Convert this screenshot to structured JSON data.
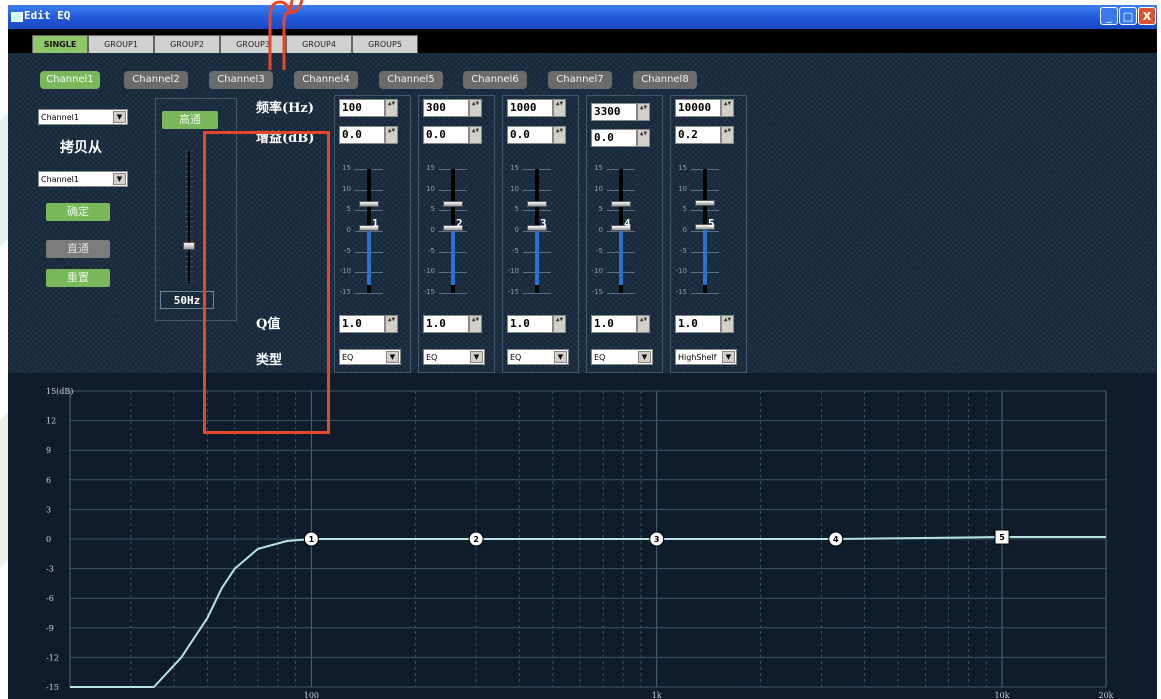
{
  "window": {
    "title": "Edit EQ",
    "min_label": "_",
    "max_label": "□",
    "close_label": "X"
  },
  "tabs": [
    "SINGLE",
    "GROUP1",
    "GROUP2",
    "GROUP3",
    "GROUP4",
    "GROUP5"
  ],
  "active_tab": "SINGLE",
  "channels": [
    "Channel1",
    "Channel2",
    "Channel3",
    "Channel4",
    "Channel5",
    "Channel6",
    "Channel7",
    "Channel8"
  ],
  "active_channel": "Channel1",
  "copy": {
    "source_select": "Channel1",
    "copy_from_label": "拷贝从",
    "target_select": "Channel1",
    "confirm_label": "确定",
    "bypass_label": "直通",
    "reset_label": "重置"
  },
  "highpass": {
    "button_label": "高通",
    "frequency": "50Hz",
    "slider_level": 0.13
  },
  "labels": {
    "freq": "频率(Hz)",
    "gain": "增益(dB)",
    "q": "Q值",
    "type": "类型"
  },
  "slider_scale": [
    "15",
    "10",
    "5",
    "0",
    "-5",
    "-10",
    "-15"
  ],
  "bands": [
    {
      "num": "1",
      "freq": "100",
      "gain": "0.0",
      "q": "1.0",
      "type": "EQ",
      "gain_db": 0.0
    },
    {
      "num": "2",
      "freq": "300",
      "gain": "0.0",
      "q": "1.0",
      "type": "EQ",
      "gain_db": 0.0
    },
    {
      "num": "3",
      "freq": "1000",
      "gain": "0.0",
      "q": "1.0",
      "type": "EQ",
      "gain_db": 0.0
    },
    {
      "num": "4",
      "freq": "3300",
      "gain": "0.0",
      "q": "1.0",
      "type": "EQ",
      "gain_db": 0.0
    },
    {
      "num": "5",
      "freq": "10000",
      "gain": "0.2",
      "q": "1.0",
      "type": "HighShelf",
      "gain_db": 0.2
    }
  ],
  "colors": {
    "curve": "#b7e4dc",
    "accent_green": "#7ab85c",
    "annotation_red": "#e8462a"
  },
  "chart_data": {
    "type": "line",
    "x_scale": "log",
    "xlim": [
      20,
      20000
    ],
    "ylim": [
      -15,
      15
    ],
    "y_ticks": [
      "15(dB)",
      "12",
      "9",
      "6",
      "3",
      "0",
      "-3",
      "-6",
      "-9",
      "-12",
      "-15"
    ],
    "y_tick_values": [
      15,
      12,
      9,
      6,
      3,
      0,
      -3,
      -6,
      -9,
      -12,
      -15
    ],
    "x_ticks": [
      "100",
      "1k",
      "10k",
      "20k"
    ],
    "x_tick_values": [
      100,
      1000,
      10000,
      20000
    ],
    "grid": true,
    "series": [
      {
        "x": [
          20,
          35,
          42,
          50,
          55,
          60,
          70,
          85,
          100,
          300,
          1000,
          3300,
          6000,
          10000,
          20000
        ],
        "y": [
          -15,
          -15,
          -12,
          -8,
          -5,
          -3,
          -1,
          -0.2,
          0,
          0,
          0,
          0,
          0.1,
          0.2,
          0.2
        ]
      }
    ],
    "markers": [
      {
        "label": "1",
        "x": 100,
        "y": 0
      },
      {
        "label": "2",
        "x": 300,
        "y": 0
      },
      {
        "label": "3",
        "x": 1000,
        "y": 0
      },
      {
        "label": "4",
        "x": 3300,
        "y": 0
      },
      {
        "label": "5",
        "x": 10000,
        "y": 0.2
      }
    ]
  }
}
